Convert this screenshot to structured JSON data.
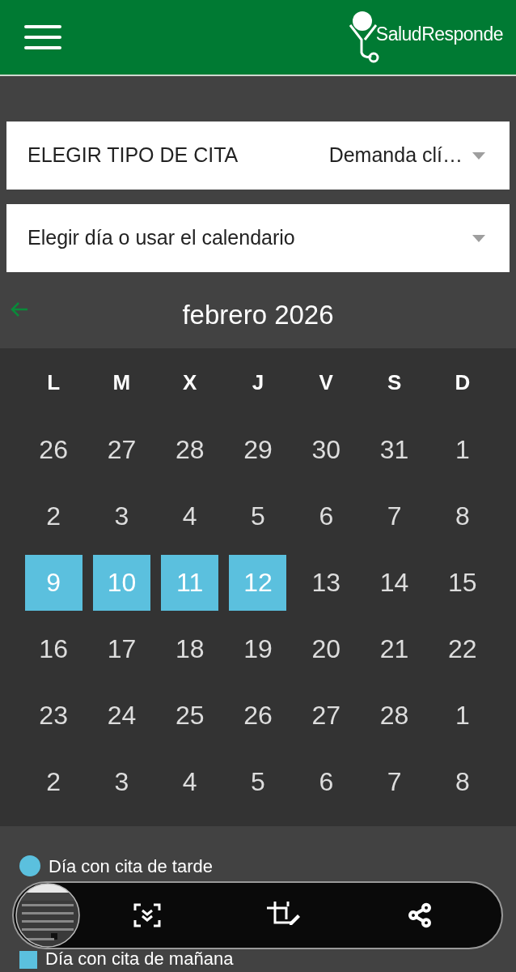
{
  "header": {
    "logo_text": "SaludResponde"
  },
  "appointment_type": {
    "label": "ELEGIR TIPO DE CITA",
    "value": "Demanda clí…"
  },
  "day_select": {
    "placeholder": "Elegir día o usar el calendario"
  },
  "calendar": {
    "month": "febrero 2026",
    "weekdays": [
      "L",
      "M",
      "X",
      "J",
      "V",
      "S",
      "D"
    ],
    "weeks": [
      [
        {
          "day": "26",
          "highlighted": false
        },
        {
          "day": "27",
          "highlighted": false
        },
        {
          "day": "28",
          "highlighted": false
        },
        {
          "day": "29",
          "highlighted": false
        },
        {
          "day": "30",
          "highlighted": false
        },
        {
          "day": "31",
          "highlighted": false
        },
        {
          "day": "1",
          "highlighted": false
        }
      ],
      [
        {
          "day": "2",
          "highlighted": false
        },
        {
          "day": "3",
          "highlighted": false
        },
        {
          "day": "4",
          "highlighted": false
        },
        {
          "day": "5",
          "highlighted": false
        },
        {
          "day": "6",
          "highlighted": false
        },
        {
          "day": "7",
          "highlighted": false
        },
        {
          "day": "8",
          "highlighted": false
        }
      ],
      [
        {
          "day": "9",
          "highlighted": true
        },
        {
          "day": "10",
          "highlighted": true
        },
        {
          "day": "11",
          "highlighted": true
        },
        {
          "day": "12",
          "highlighted": true
        },
        {
          "day": "13",
          "highlighted": false
        },
        {
          "day": "14",
          "highlighted": false
        },
        {
          "day": "15",
          "highlighted": false
        }
      ],
      [
        {
          "day": "16",
          "highlighted": false
        },
        {
          "day": "17",
          "highlighted": false
        },
        {
          "day": "18",
          "highlighted": false
        },
        {
          "day": "19",
          "highlighted": false
        },
        {
          "day": "20",
          "highlighted": false
        },
        {
          "day": "21",
          "highlighted": false
        },
        {
          "day": "22",
          "highlighted": false
        }
      ],
      [
        {
          "day": "23",
          "highlighted": false
        },
        {
          "day": "24",
          "highlighted": false
        },
        {
          "day": "25",
          "highlighted": false
        },
        {
          "day": "26",
          "highlighted": false
        },
        {
          "day": "27",
          "highlighted": false
        },
        {
          "day": "28",
          "highlighted": false
        },
        {
          "day": "1",
          "highlighted": false
        }
      ],
      [
        {
          "day": "2",
          "highlighted": false
        },
        {
          "day": "3",
          "highlighted": false
        },
        {
          "day": "4",
          "highlighted": false
        },
        {
          "day": "5",
          "highlighted": false
        },
        {
          "day": "6",
          "highlighted": false
        },
        {
          "day": "7",
          "highlighted": false
        },
        {
          "day": "8",
          "highlighted": false
        }
      ]
    ]
  },
  "legend": [
    {
      "kind": "dot",
      "color": "#5bc0de",
      "label": "Día con cita de tarde"
    },
    {
      "kind": "square",
      "color": "#5bc0de",
      "label": "Día con cita de mañana"
    }
  ]
}
